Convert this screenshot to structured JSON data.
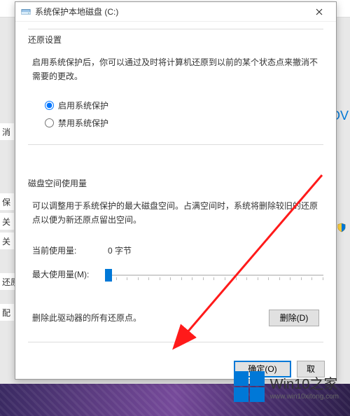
{
  "dialog": {
    "title": "系统保护本地磁盘 (C:)",
    "restore_section": {
      "title": "还原设置",
      "description": "启用系统保护后，你可以通过及时将计算机还原到以前的某个状态点来撤消不需要的更改。",
      "radio_enable": "启用系统保护",
      "radio_disable": "禁用系统保护"
    },
    "disk_section": {
      "title": "磁盘空间使用量",
      "description": "可以调整用于系统保护的最大磁盘空间。占满空间时，系统将删除较旧的还原点以便为新还原点留出空间。",
      "current_usage_label": "当前使用量:",
      "current_usage_value": "0 字节",
      "max_usage_label": "最大使用量(M):",
      "slider_value": 1
    },
    "delete_section": {
      "label": "删除此驱动器的所有还原点。",
      "button": "删除(D)"
    },
    "buttons": {
      "ok": "确定(O)",
      "cancel": "取"
    }
  },
  "background": {
    "row_cancel": "消",
    "row_bao": "保",
    "row_guan1": "关",
    "row_guan2": "关",
    "row_huanyuan": "还原",
    "row_pei": "配",
    "ov_text": "OV"
  },
  "watermark": {
    "title": "Win10之家",
    "url": "www.win10xitong.com"
  }
}
